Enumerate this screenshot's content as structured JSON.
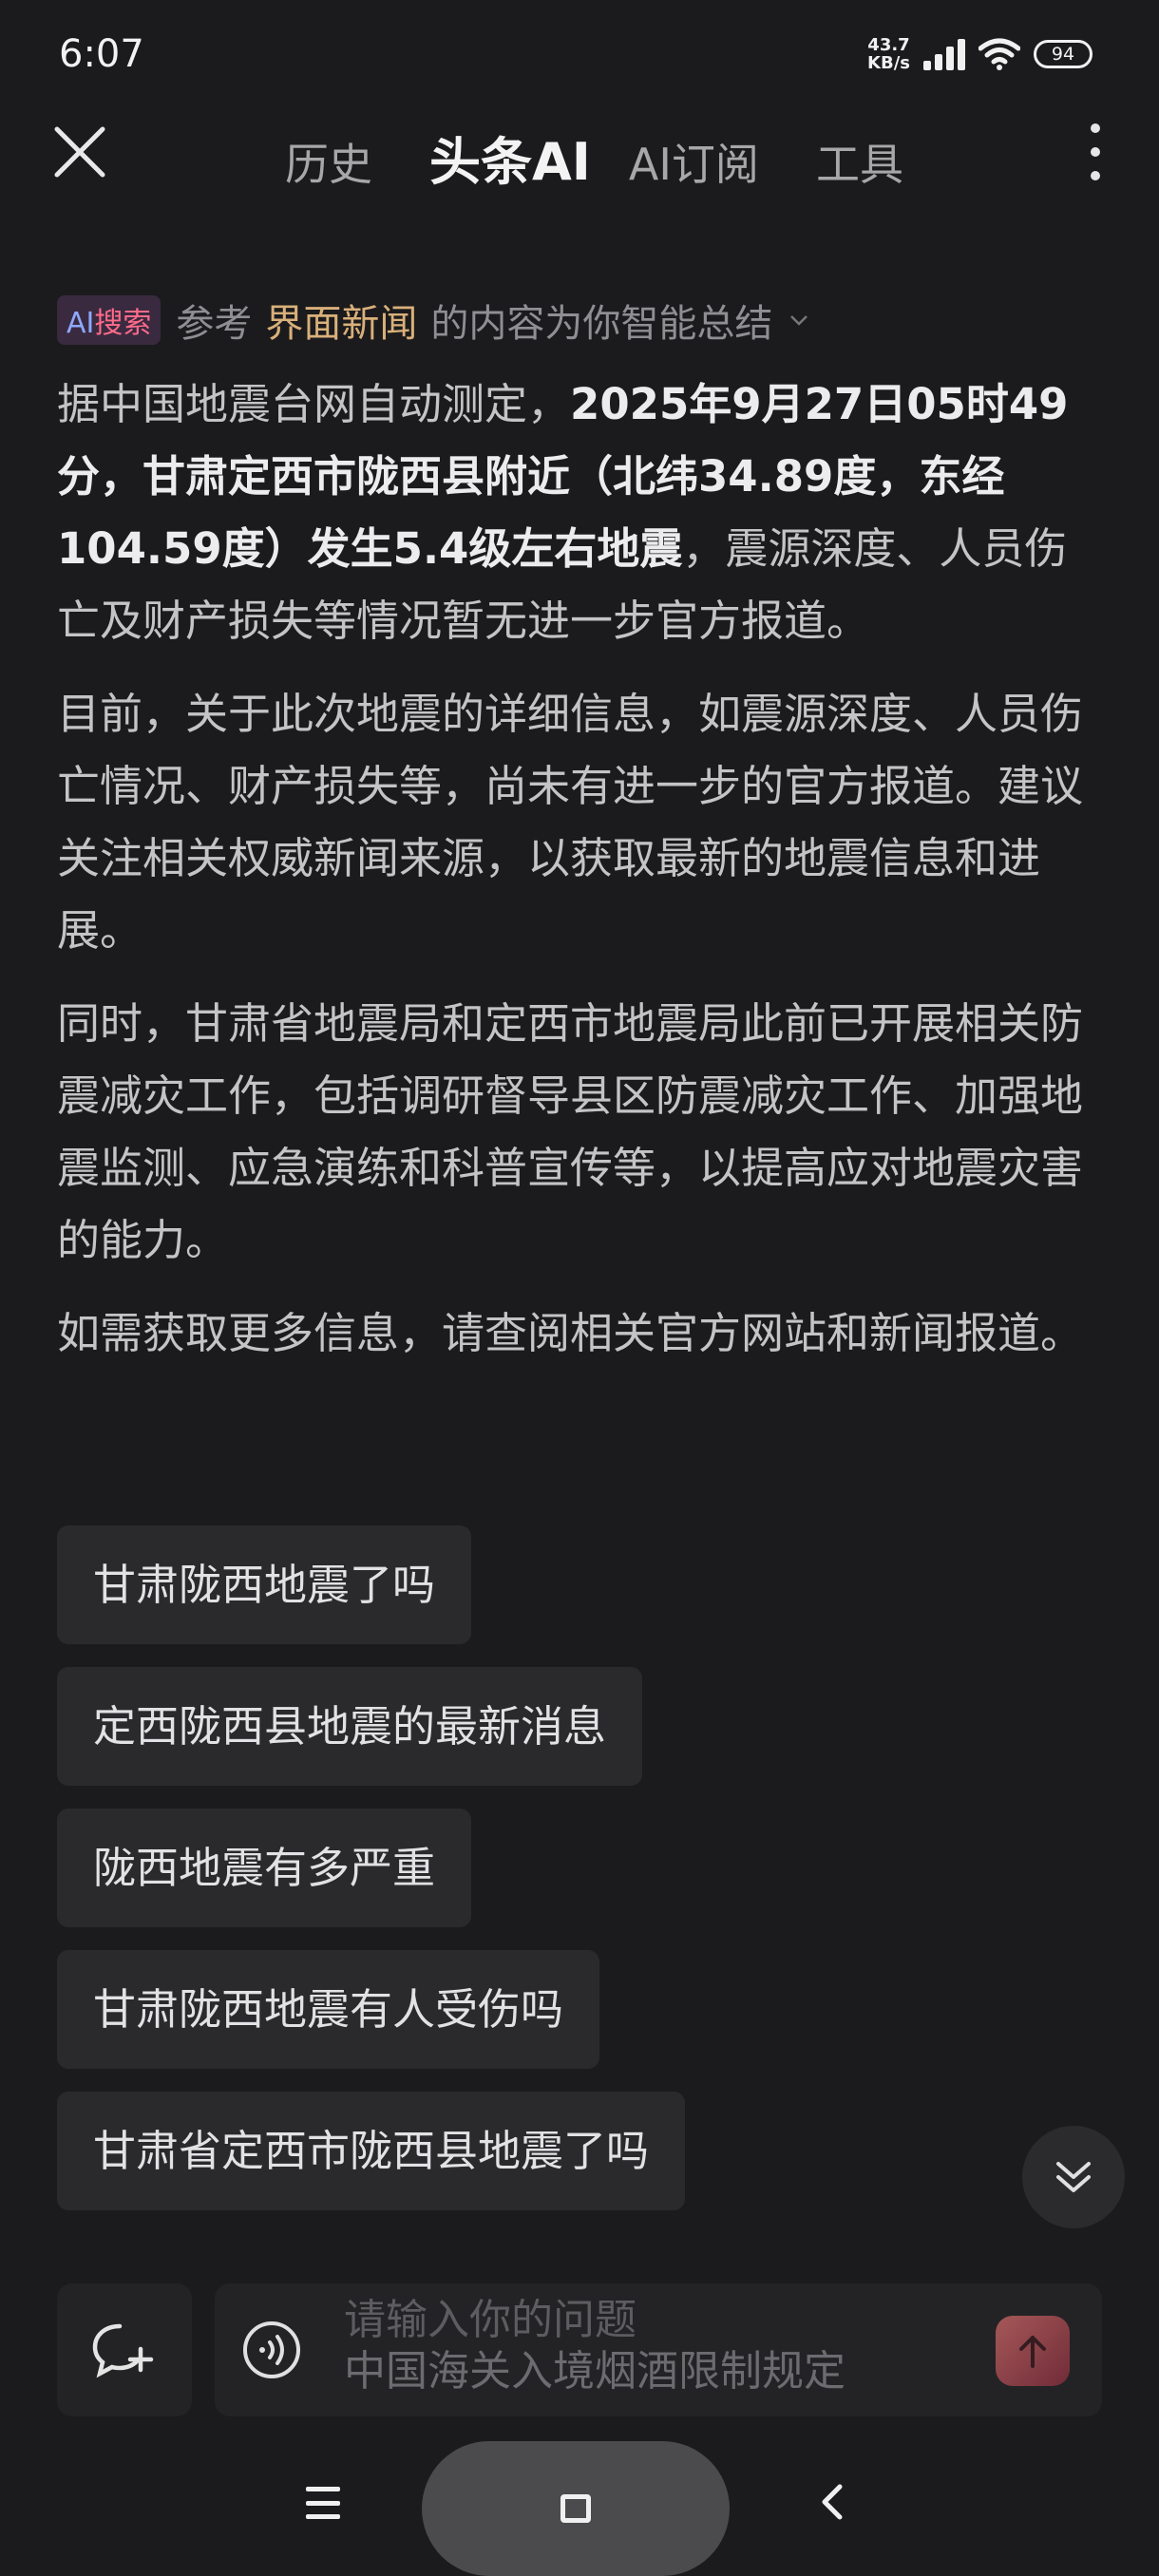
{
  "status_bar": {
    "time": "6:07",
    "net_speed_value": "43.7",
    "net_speed_unit": "KB/s",
    "battery": "94"
  },
  "header": {
    "tabs": [
      {
        "label": "历史"
      },
      {
        "label": "头条AI",
        "active": true
      },
      {
        "label": "AI订阅"
      },
      {
        "label": "工具"
      }
    ]
  },
  "source": {
    "badge_ai": "AI",
    "badge_search": "搜索",
    "prefix": "参考",
    "name": "界面新闻",
    "suffix": "的内容为你智能总结"
  },
  "answer": {
    "p1_lead": "据中国地震台网自动测定，",
    "p1_bold": "2025年9月27日05时49分，甘肃定西市陇西县附近（北纬34.89度，东经104.59度）发生5.4级左右地震",
    "p1_tail": "，震源深度、人员伤亡及财产损失等情况暂无进一步官方报道。",
    "p2": "目前，关于此次地震的详细信息，如震源深度、人员伤亡情况、财产损失等，尚未有进一步的官方报道。建议关注相关权威新闻来源，以获取最新的地震信息和进展。",
    "p3": "同时，甘肃省地震局和定西市地震局此前已开展相关防震减灾工作，包括调研督导县区防震减灾工作、加强地震监测、应急演练和科普宣传等，以提高应对地震灾害的能力。",
    "p4": "如需获取更多信息，请查阅相关官方网站和新闻报道。"
  },
  "suggestions": [
    "甘肃陇西地震了吗",
    "定西陇西县地震的最新消息",
    "陇西地震有多严重",
    "甘肃陇西地震有人受伤吗",
    "甘肃省定西市陇西县地震了吗"
  ],
  "input": {
    "placeholder": "请输入你的问题",
    "hint": "中国海关入境烟酒限制规定"
  },
  "colors": {
    "background": "#1b1b1d",
    "source_name": "#d9b07a",
    "chip_bg": "#2a2a2d",
    "send_accent": "#c0505e"
  },
  "icons": [
    "close-icon",
    "more-icon",
    "chevron-down-icon",
    "scroll-down-icon",
    "new-chat-icon",
    "voice-icon",
    "send-arrow-icon",
    "menu-icon",
    "home-icon",
    "back-icon"
  ]
}
